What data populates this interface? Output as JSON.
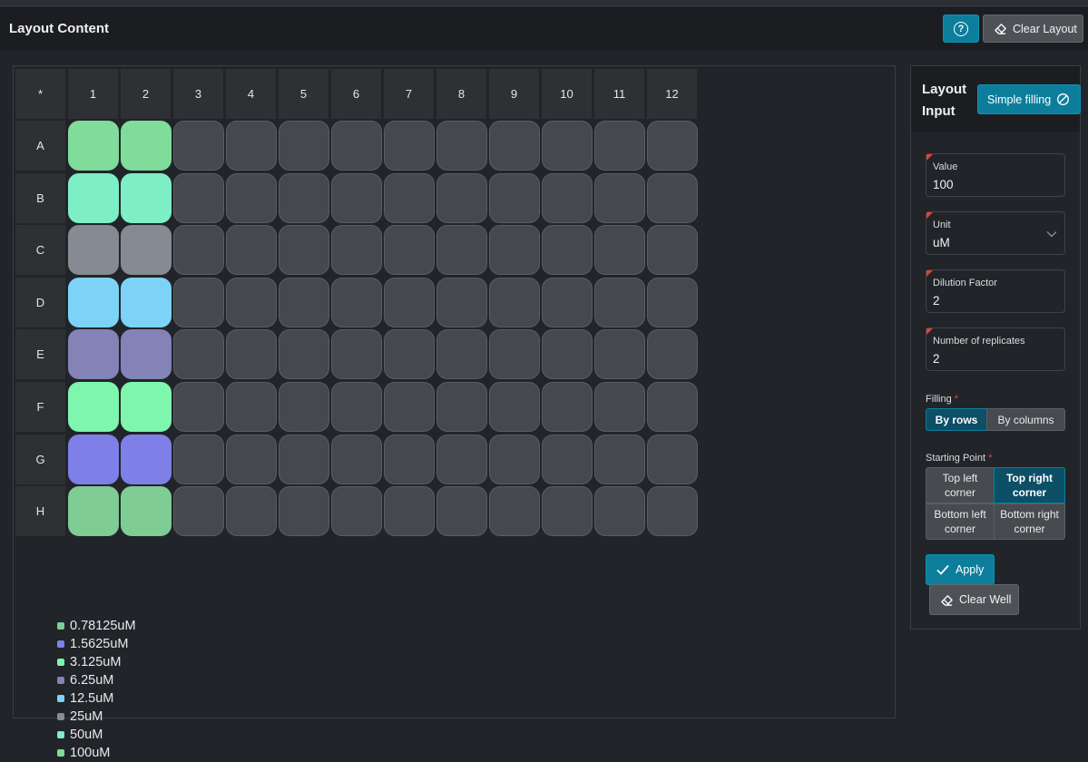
{
  "header": {
    "title": "Layout Content",
    "help_icon": "question-circle-icon",
    "clear_layout_label": "Clear Layout"
  },
  "plate": {
    "corner": "*",
    "columns": [
      "1",
      "2",
      "3",
      "4",
      "5",
      "6",
      "7",
      "8",
      "9",
      "10",
      "11",
      "12"
    ],
    "rows": [
      "A",
      "B",
      "C",
      "D",
      "E",
      "F",
      "G",
      "H"
    ],
    "filled": [
      {
        "row": "A",
        "cols": [
          1,
          2
        ],
        "color": "#7fdc9a"
      },
      {
        "row": "B",
        "cols": [
          1,
          2
        ],
        "color": "#7deec6"
      },
      {
        "row": "C",
        "cols": [
          1,
          2
        ],
        "color": "#868a92"
      },
      {
        "row": "D",
        "cols": [
          1,
          2
        ],
        "color": "#7dd3f7"
      },
      {
        "row": "E",
        "cols": [
          1,
          2
        ],
        "color": "#8383b8"
      },
      {
        "row": "F",
        "cols": [
          1,
          2
        ],
        "color": "#7ef6ae"
      },
      {
        "row": "G",
        "cols": [
          1,
          2
        ],
        "color": "#7f7fe8"
      },
      {
        "row": "H",
        "cols": [
          1,
          2
        ],
        "color": "#7fcc94"
      }
    ],
    "empty_color": "#46484d"
  },
  "legend": [
    {
      "label": "0.78125uM",
      "color": "#7fcc94"
    },
    {
      "label": "1.5625uM",
      "color": "#7f7fe8"
    },
    {
      "label": "3.125uM",
      "color": "#7ef6ae"
    },
    {
      "label": "6.25uM",
      "color": "#8383b8"
    },
    {
      "label": "12.5uM",
      "color": "#7dd3f7"
    },
    {
      "label": "25uM",
      "color": "#868a92"
    },
    {
      "label": "50uM",
      "color": "#7deec6"
    },
    {
      "label": "100uM",
      "color": "#7fdc9a"
    }
  ],
  "side": {
    "title_line1": "Layout",
    "title_line2": "Input",
    "simple_filling_label": "Simple filling",
    "fields": {
      "value": {
        "label": "Value",
        "value": "100"
      },
      "unit": {
        "label": "Unit",
        "value": "uM"
      },
      "dilution": {
        "label": "Dilution Factor",
        "value": "2"
      },
      "replicates": {
        "label": "Number of replicates",
        "value": "2"
      }
    },
    "filling": {
      "label": "Filling",
      "star": "*",
      "by_rows": "By rows",
      "by_columns": "By columns",
      "selected": "By rows"
    },
    "starting_point": {
      "label": "Starting Point",
      "star": "*",
      "top_left": "Top left corner",
      "top_right": "Top right corner",
      "bottom_left": "Bottom left corner",
      "bottom_right": "Bottom right corner",
      "selected": "Top right corner"
    },
    "apply_label": "Apply",
    "clear_well_label": "Clear Well"
  },
  "colors": {
    "accent": "#0c7e9c",
    "active_segment": "#0d4f66",
    "required": "#d9453b"
  }
}
